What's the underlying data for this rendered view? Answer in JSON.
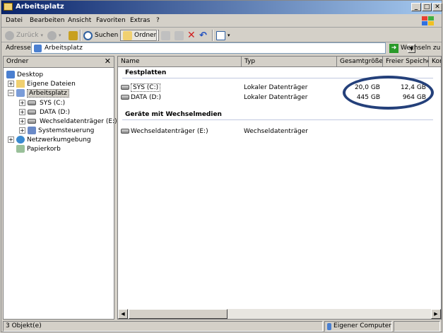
{
  "window": {
    "title": "Arbeitsplatz"
  },
  "menu": [
    "Datei",
    "Bearbeiten",
    "Ansicht",
    "Favoriten",
    "Extras",
    "?"
  ],
  "toolbar": {
    "back": "Zurück",
    "search": "Suchen",
    "folders": "Ordner"
  },
  "address": {
    "label": "Adresse",
    "value": "Arbeitsplatz",
    "go": "Wechseln zu"
  },
  "tree": {
    "title": "Ordner",
    "close": "✕",
    "items": [
      {
        "label": "Desktop"
      },
      {
        "label": "Eigene Dateien"
      },
      {
        "label": "Arbeitsplatz"
      },
      {
        "label": "SYS (C:)"
      },
      {
        "label": "DATA (D:)"
      },
      {
        "label": "Wechseldatenträger (E:)"
      },
      {
        "label": "Systemsteuerung"
      },
      {
        "label": "Netzwerkumgebung"
      },
      {
        "label": "Papierkorb"
      }
    ]
  },
  "list": {
    "columns": [
      "Name",
      "Typ",
      "Gesamtgröße",
      "Freier Speicher",
      "Kom"
    ],
    "groups": [
      {
        "title": "Festplatten",
        "rows": [
          {
            "name": "SYS (C:)",
            "type": "Lokaler Datenträger",
            "total": "20,0 GB",
            "free": "12,4 GB"
          },
          {
            "name": "DATA (D:)",
            "type": "Lokaler Datenträger",
            "total": "445 GB",
            "free": "964 GB"
          }
        ]
      },
      {
        "title": "Geräte mit Wechselmedien",
        "rows": [
          {
            "name": "Wechseldatenträger (E:)",
            "type": "Wechseldatenträger",
            "total": "",
            "free": ""
          }
        ]
      }
    ]
  },
  "status": {
    "count": "3 Objekt(e)",
    "zone": "Eigener Computer"
  },
  "colors": {
    "title_gradient_start": "#0a246a",
    "title_gradient_end": "#a6caf0",
    "highlight_oval": "#24407a"
  }
}
